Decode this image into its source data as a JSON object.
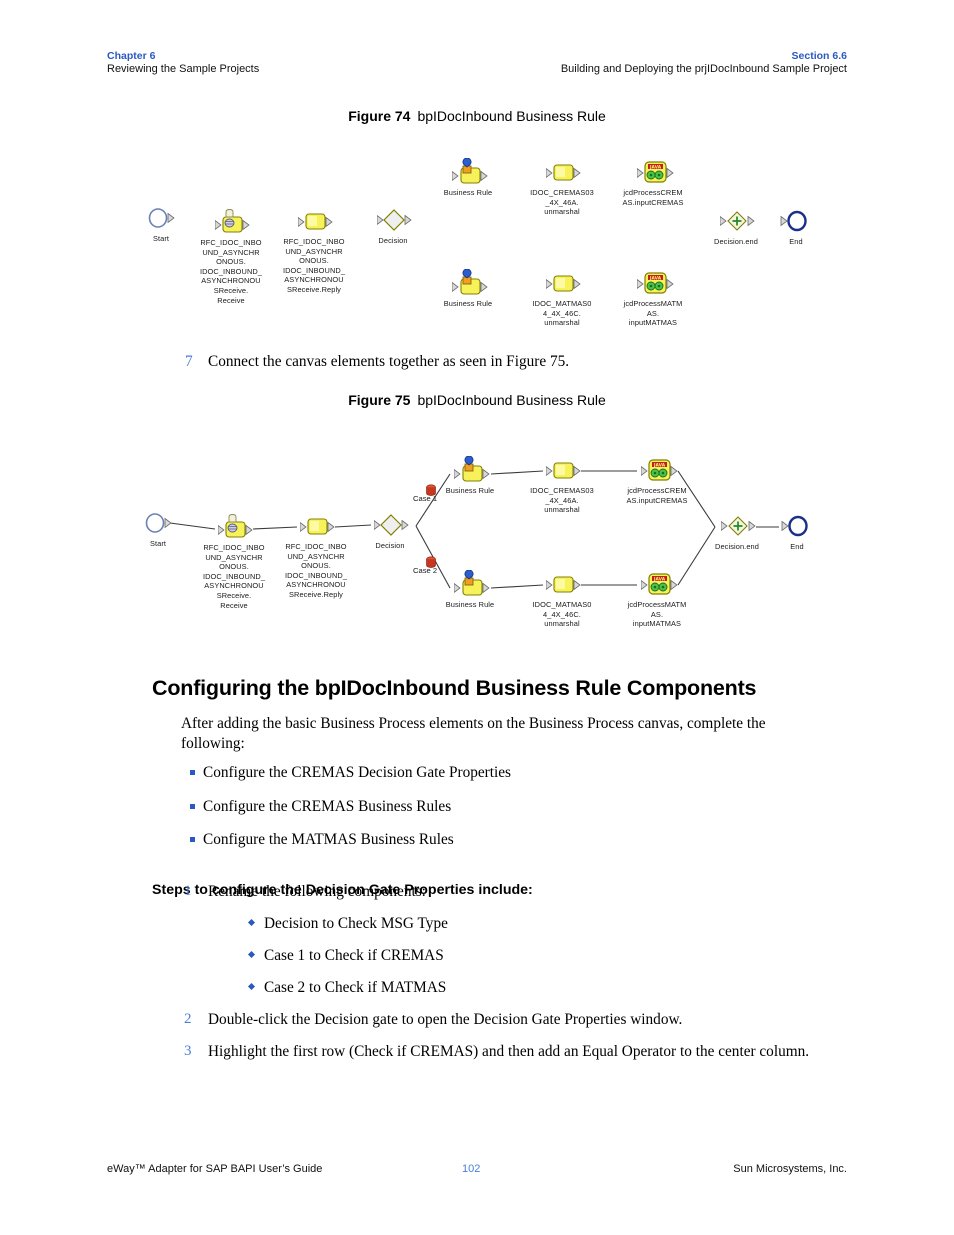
{
  "runhead": {
    "left_top": "Chapter 6",
    "left_bottom": "Reviewing the Sample Projects",
    "right_top": "Section 6.6",
    "right_bottom": "Building and Deploying the prjIDocInbound Sample Project"
  },
  "figure74": {
    "caption_number": "Figure 74",
    "caption_title": "bpIDocInbound Business Rule",
    "nodes": [
      {
        "name": "start",
        "icon": "start-circle-icon",
        "label": "Start"
      },
      {
        "name": "receive",
        "icon": "receive-activity-icon",
        "label": "RFC_IDOC_INBO\nUND_ASYNCHR\nONOUS.\nIDOC_INBOUND_\nASYNCHRONOU\nSReceive.\nReceive"
      },
      {
        "name": "receive-reply",
        "icon": "activity-icon",
        "label": "RFC_IDOC_INBO\nUND_ASYNCHR\nONOUS.\nIDOC_INBOUND_\nASYNCHRONOU\nSReceive.Reply"
      },
      {
        "name": "decision",
        "icon": "decision-diamond-icon",
        "label": "Decision"
      },
      {
        "name": "business-rule-cremas",
        "icon": "business-rule-icon",
        "label": "Business Rule"
      },
      {
        "name": "idoc-cremas-unmarshal",
        "icon": "activity-icon",
        "label": "IDOC_CREMAS03\n_4X_46A.\nunmarshal"
      },
      {
        "name": "jcd-process-cremas",
        "icon": "java-collaboration-icon",
        "label": "jcdProcessCREM\nAS.inputCREMAS"
      },
      {
        "name": "business-rule-matmas",
        "icon": "business-rule-icon",
        "label": "Business Rule"
      },
      {
        "name": "idoc-matmas-unmarshal",
        "icon": "activity-icon",
        "label": "IDOC_MATMAS0\n4_4X_46C.\nunmarshal"
      },
      {
        "name": "jcd-process-matmas",
        "icon": "java-collaboration-icon",
        "label": "jcdProcessMATM\nAS.\ninputMATMAS"
      },
      {
        "name": "decision-end",
        "icon": "decision-end-icon",
        "label": "Decision.end"
      },
      {
        "name": "end",
        "icon": "end-circle-icon",
        "label": "End"
      }
    ]
  },
  "step7": {
    "number": "7",
    "text": "Connect the canvas elements together as seen in Figure 75."
  },
  "figure75": {
    "caption_number": "Figure 75",
    "caption_title": "bpIDocInbound Business Rule",
    "case1_label": "Case 1",
    "case2_label": "Case 2",
    "nodes": [
      {
        "name": "start",
        "icon": "start-circle-icon",
        "label": "Start"
      },
      {
        "name": "receive",
        "icon": "receive-activity-icon",
        "label": "RFC_IDOC_INBO\nUND_ASYNCHR\nONOUS.\nIDOC_INBOUND_\nASYNCHRONOU\nSReceive.\nReceive"
      },
      {
        "name": "receive-reply",
        "icon": "activity-icon",
        "label": "RFC_IDOC_INBO\nUND_ASYNCHR\nONOUS.\nIDOC_INBOUND_\nASYNCHRONOU\nSReceive.Reply"
      },
      {
        "name": "decision",
        "icon": "decision-diamond-icon",
        "label": "Decision"
      },
      {
        "name": "business-rule-cremas",
        "icon": "business-rule-icon",
        "label": "Business Rule"
      },
      {
        "name": "idoc-cremas-unmarshal",
        "icon": "activity-icon",
        "label": "IDOC_CREMAS03\n_4X_46A.\nunmarshal"
      },
      {
        "name": "jcd-process-cremas",
        "icon": "java-collaboration-icon",
        "label": "jcdProcessCREM\nAS.inputCREMAS"
      },
      {
        "name": "business-rule-matmas",
        "icon": "business-rule-icon",
        "label": "Business Rule"
      },
      {
        "name": "idoc-matmas-unmarshal",
        "icon": "activity-icon",
        "label": "IDOC_MATMAS0\n4_4X_46C.\nunmarshal"
      },
      {
        "name": "jcd-process-matmas",
        "icon": "java-collaboration-icon",
        "label": "jcdProcessMATM\nAS.\ninputMATMAS"
      },
      {
        "name": "decision-end",
        "icon": "decision-end-icon",
        "label": "Decision.end"
      },
      {
        "name": "end",
        "icon": "end-circle-icon",
        "label": "End"
      }
    ]
  },
  "section": {
    "heading": "Configuring the bpIDocInbound Business Rule Components",
    "intro": "After adding the basic Business Process elements on the Business Process canvas, complete the following:",
    "bullets": [
      "Configure the CREMAS Decision Gate Properties",
      "Configure the CREMAS Business Rules",
      "Configure the MATMAS Business Rules"
    ],
    "steps_lead": "Steps to configure the Decision Gate Properties include:",
    "steps": [
      {
        "num": "1",
        "text": "Rename the following components:",
        "subitems": [
          "Decision to Check MSG Type",
          "Case 1 to Check if CREMAS",
          "Case 2 to Check if MATMAS"
        ]
      },
      {
        "num": "2",
        "text": "Double-click the Decision gate to open the Decision Gate Properties window.",
        "subitems": []
      },
      {
        "num": "3",
        "text": "Highlight the first row (Check if CREMAS) and then add an Equal Operator to the center column.",
        "subitems": []
      }
    ]
  },
  "footer": {
    "left": "eWay™ Adapter for SAP BAPI User’s Guide",
    "page": "102",
    "right": "Sun Microsystems, Inc."
  },
  "colors": {
    "accent_blue": "#2b59c3",
    "light_blue": "#4a7ddb",
    "node_yellow": "#f7f25a",
    "node_border": "#808000",
    "end_navy": "#1b2f8a",
    "case_red": "#cc2a1a"
  }
}
